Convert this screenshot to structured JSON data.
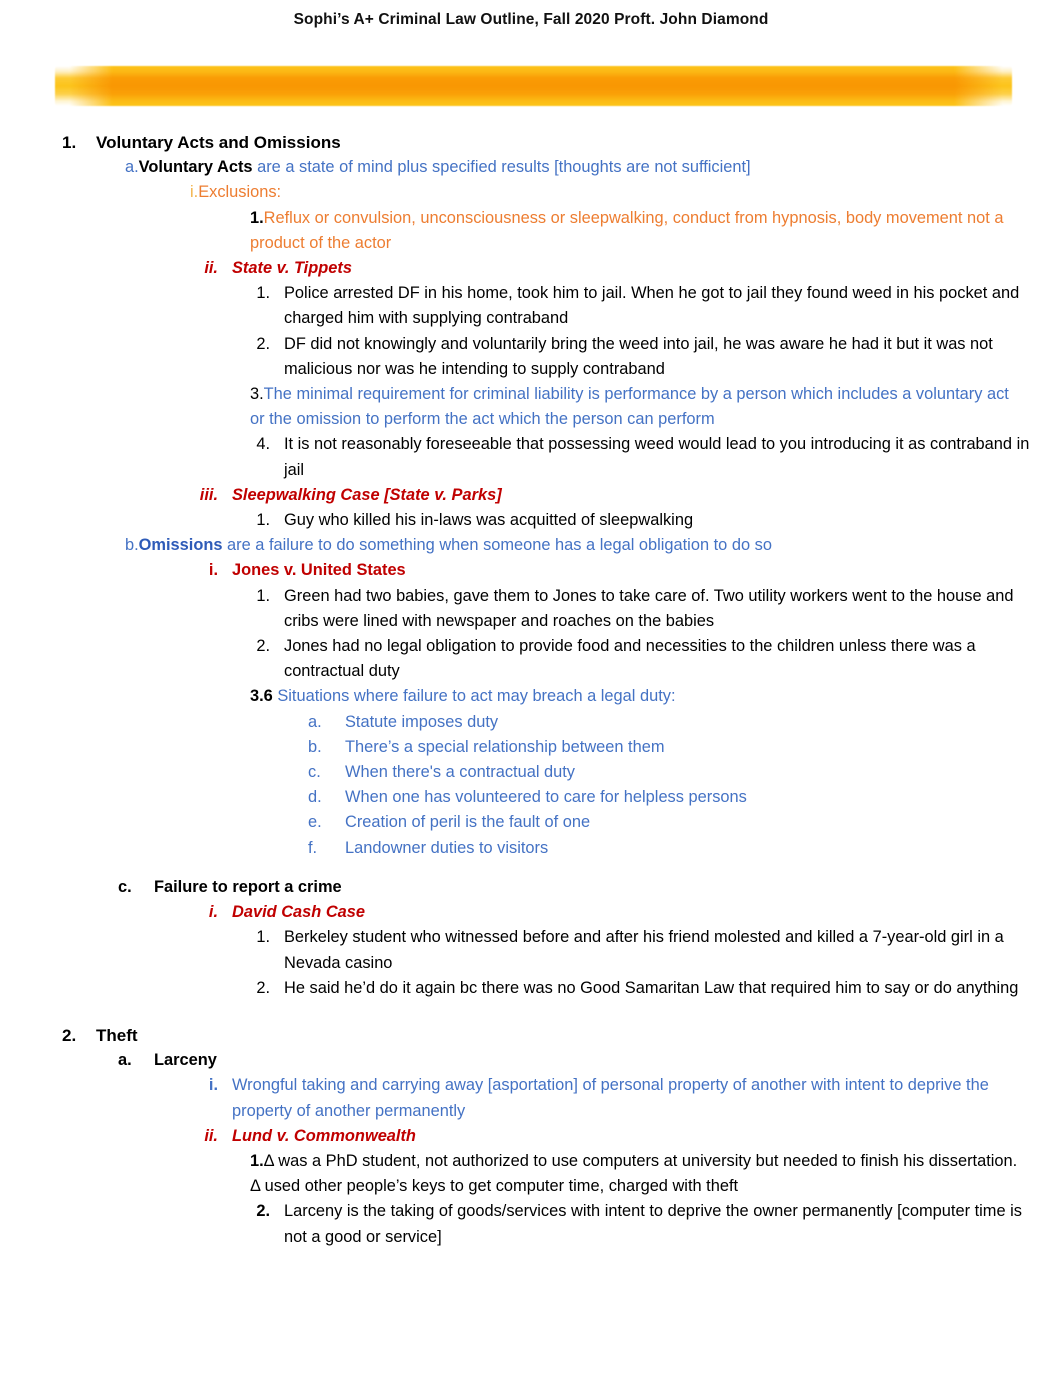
{
  "document": {
    "header": {
      "title": "Sophi’s A+ Criminal Law Outline, Fall 2020 Proft. John Diamond",
      "banner_color": "#FCC41A"
    },
    "colors": {
      "black": "#000000",
      "blue": "#4472C4",
      "blue_bold": "#2E5BB8",
      "orange": "#ED7D31",
      "gold": "#F2B34A",
      "red": "#C00000"
    }
  },
  "outline": {
    "s1": {
      "marker": "1.",
      "title": "Voluntary Acts and Omissions",
      "a": {
        "marker": "a.",
        "lead": "Voluntary Acts",
        "text": " are a state of mind plus specified results [thoughts are not sufficient]",
        "i": {
          "marker": "i.",
          "text": "Exclusions:",
          "n1": {
            "marker": "1.",
            "text": "Reflux or convulsion, unconsciousness or sleepwalking, conduct from hypnosis, body movement not a product of the actor"
          }
        },
        "ii": {
          "marker": "ii.",
          "case": "State v. Tippets",
          "points": [
            {
              "marker": "1.",
              "text": "Police arrested DF in his home, took him to jail. When he got to jail they found weed in his pocket and charged him with supplying contraband"
            },
            {
              "marker": "2.",
              "text": "DF did not knowingly and voluntarily bring the weed into jail, he was aware he had it but it was not malicious nor was he intending to supply contraband"
            },
            {
              "marker": "3.",
              "text": "The minimal requirement for criminal liability is performance by a person which includes a voluntary act or the omission to perform the act which the person can perform"
            },
            {
              "marker": "4.",
              "text": "It is not reasonably foreseeable that possessing weed would lead to you introducing it as contraband in jail"
            }
          ]
        },
        "iii": {
          "marker": "iii.",
          "case": "Sleepwalking Case [State v. Parks]",
          "points": [
            {
              "marker": "1.",
              "text": "Guy who killed his in-laws was acquitted of sleepwalking"
            }
          ]
        }
      },
      "b": {
        "marker": "b.",
        "lead": "Omissions",
        "text": " are a failure to do something when someone has a legal obligation to do so",
        "i": {
          "marker": "i.",
          "case": "Jones v. United States",
          "points": [
            {
              "marker": "1.",
              "text": "Green had two babies, gave them to Jones to take care of. Two utility workers went to the house and cribs were lined with newspaper and roaches on the babies"
            },
            {
              "marker": "2.",
              "text": "Jones had no legal obligation to provide food and necessities to the children unless there was a contractual duty"
            }
          ],
          "duty": {
            "marker": "3.6",
            "text": "Situations where failure to act may breach a legal duty:",
            "items": [
              {
                "marker": "a.",
                "text": "Statute imposes duty"
              },
              {
                "marker": "b.",
                "text": "There’s a special relationship between them"
              },
              {
                "marker": "c.",
                "text": "When there's a contractual duty"
              },
              {
                "marker": "d.",
                "text": "When one has volunteered to care for helpless persons"
              },
              {
                "marker": "e.",
                "text": "Creation of peril is the fault of one"
              },
              {
                "marker": "f.",
                "text": "Landowner duties to visitors"
              }
            ]
          }
        }
      },
      "c": {
        "marker": "c.",
        "title": "Failure to report a crime",
        "i": {
          "marker": "i.",
          "case": "David Cash Case",
          "points": [
            {
              "marker": "1.",
              "text": "Berkeley student who witnessed before and after his friend molested and killed a 7-year-old girl in a Nevada casino"
            },
            {
              "marker": "2.",
              "text": "He said he’d do it again bc there was no Good Samaritan Law that required him to say or do anything"
            }
          ]
        }
      }
    },
    "s2": {
      "marker": "2.",
      "title": "Theft",
      "a": {
        "marker": "a.",
        "title": "Larceny",
        "i": {
          "marker": "i.",
          "text": "Wrongful taking and carrying away [asportation] of personal property of another with intent to deprive the property of another permanently"
        },
        "ii": {
          "marker": "ii.",
          "case": "Lund v. Commonwealth",
          "points": [
            {
              "marker": "1.",
              "text": "Δ was a PhD student, not authorized to use computers at university but needed to finish his dissertation. Δ used other people’s keys to get computer time, charged with theft"
            },
            {
              "marker": "2.",
              "text": "Larceny is the taking of goods/services with intent to deprive the owner permanently [computer time is not a good or service]"
            }
          ]
        }
      }
    }
  }
}
